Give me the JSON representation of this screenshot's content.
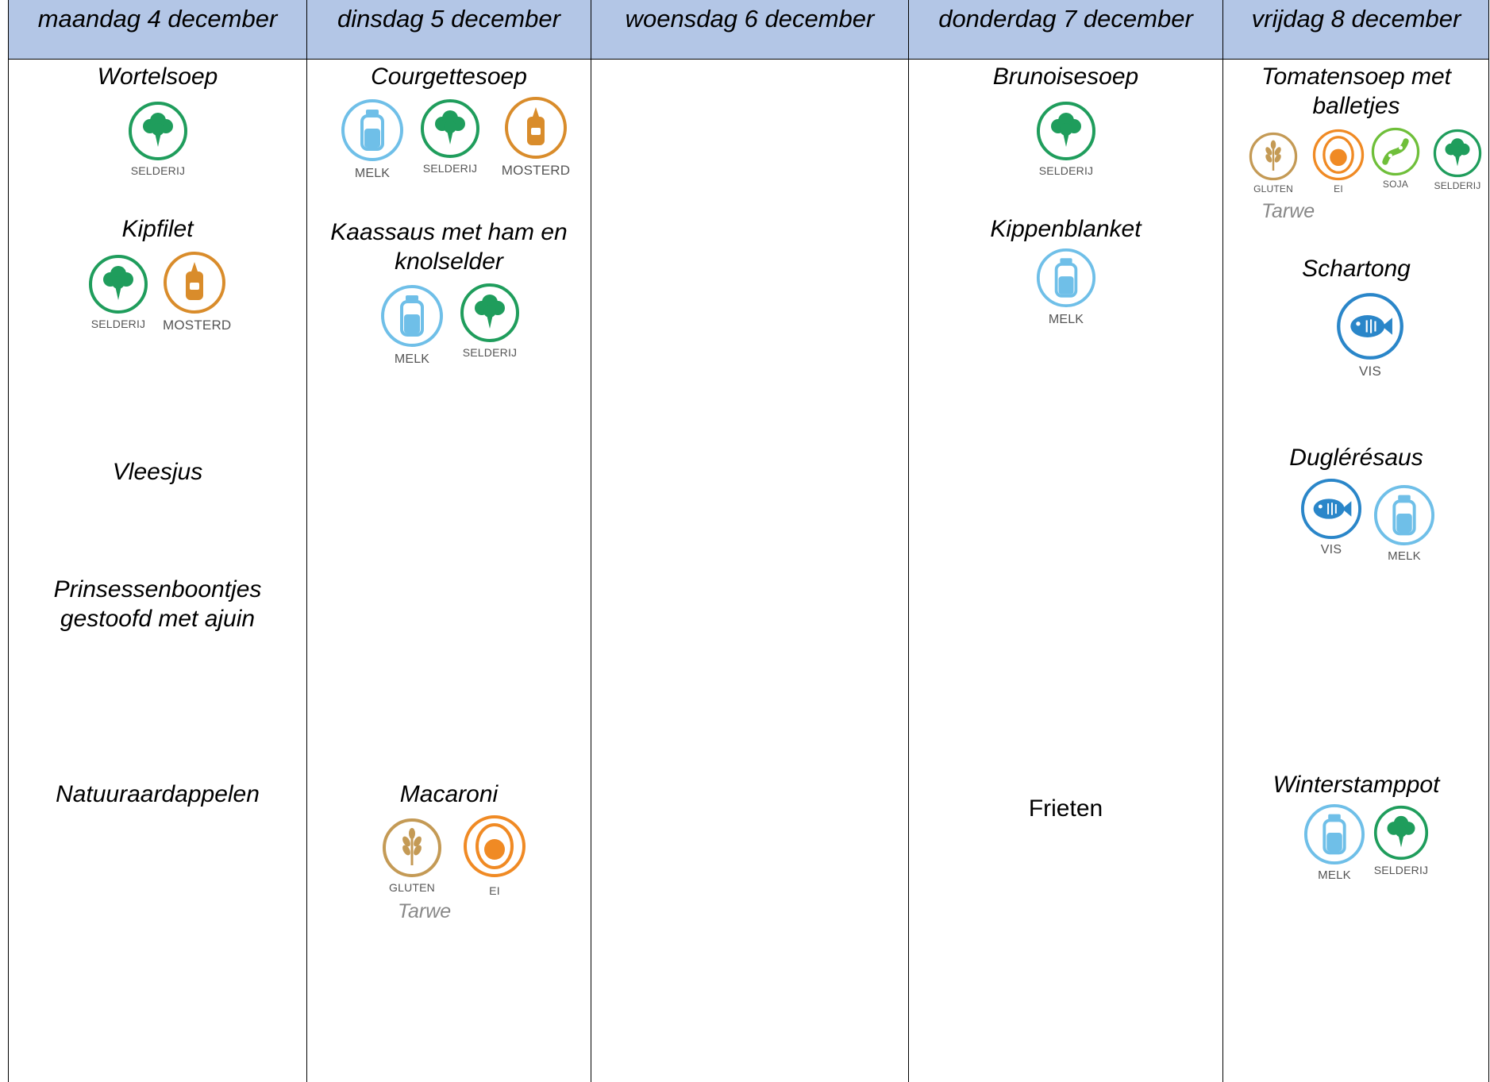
{
  "days": [
    {
      "label": "maandag 4 december"
    },
    {
      "label": "dinsdag 5 december"
    },
    {
      "label": "woensdag 6 december"
    },
    {
      "label": "donderdag 7 december"
    },
    {
      "label": "vrijdag 8 december"
    }
  ],
  "allergen_labels": {
    "selderij": "SELDERIJ",
    "mosterd": "MOSTERD",
    "melk": "MELK",
    "gluten": "GLUTEN",
    "ei": "EI",
    "soja": "SOJA",
    "vis": "VIS"
  },
  "colors": {
    "header": "#b3c6e6",
    "selderij": "#1f9d5c",
    "mosterd": "#d98c2b",
    "melk": "#6fbfe8",
    "gluten": "#c49a55",
    "ei": "#f08a24",
    "soja": "#6fbf3a",
    "vis": "#2a86c9"
  },
  "monday": {
    "soup": "Wortelsoep",
    "main": "Kipfilet",
    "sauce": "Vleesjus",
    "veg_line1": "Prinsessenboontjes",
    "veg_line2": "gestoofd met ajuin",
    "side": "Natuuraardappelen"
  },
  "tuesday": {
    "soup": "Courgettesoep",
    "main_line1": "Kaassaus met ham en",
    "main_line2": "knolselder",
    "side": "Macaroni",
    "side_note": "Tarwe"
  },
  "thursday": {
    "soup": "Brunoisesoep",
    "main": "Kippenblanket",
    "side": "Frieten"
  },
  "friday": {
    "soup_line1": "Tomatensoep met",
    "soup_line2": "balletjes",
    "soup_note": "Tarwe",
    "main": "Schartong",
    "sauce": "Duglérésaus",
    "side": "Winterstamppot"
  }
}
